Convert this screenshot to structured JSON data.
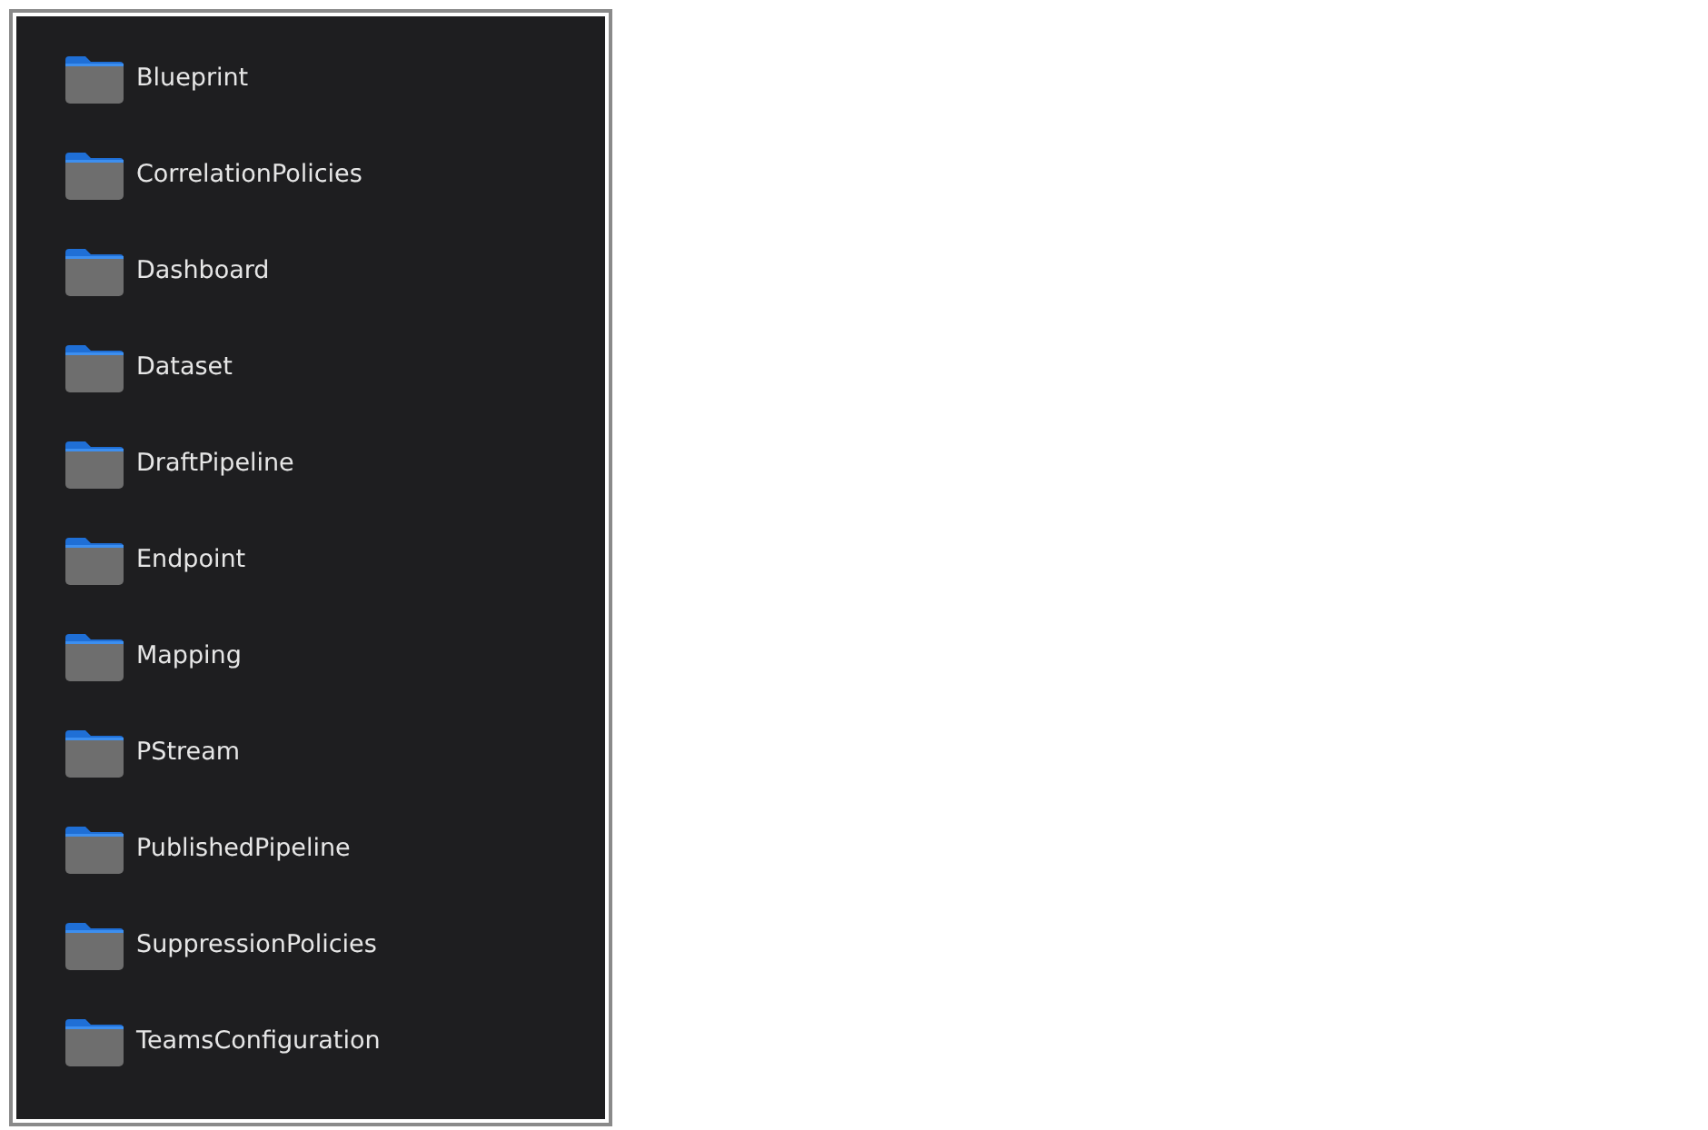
{
  "folders": [
    {
      "name": "Blueprint"
    },
    {
      "name": "CorrelationPolicies"
    },
    {
      "name": "Dashboard"
    },
    {
      "name": "Dataset"
    },
    {
      "name": "DraftPipeline"
    },
    {
      "name": "Endpoint"
    },
    {
      "name": "Mapping"
    },
    {
      "name": "PStream"
    },
    {
      "name": "PublishedPipeline"
    },
    {
      "name": "SuppressionPolicies"
    },
    {
      "name": "TeamsConfiguration"
    }
  ]
}
